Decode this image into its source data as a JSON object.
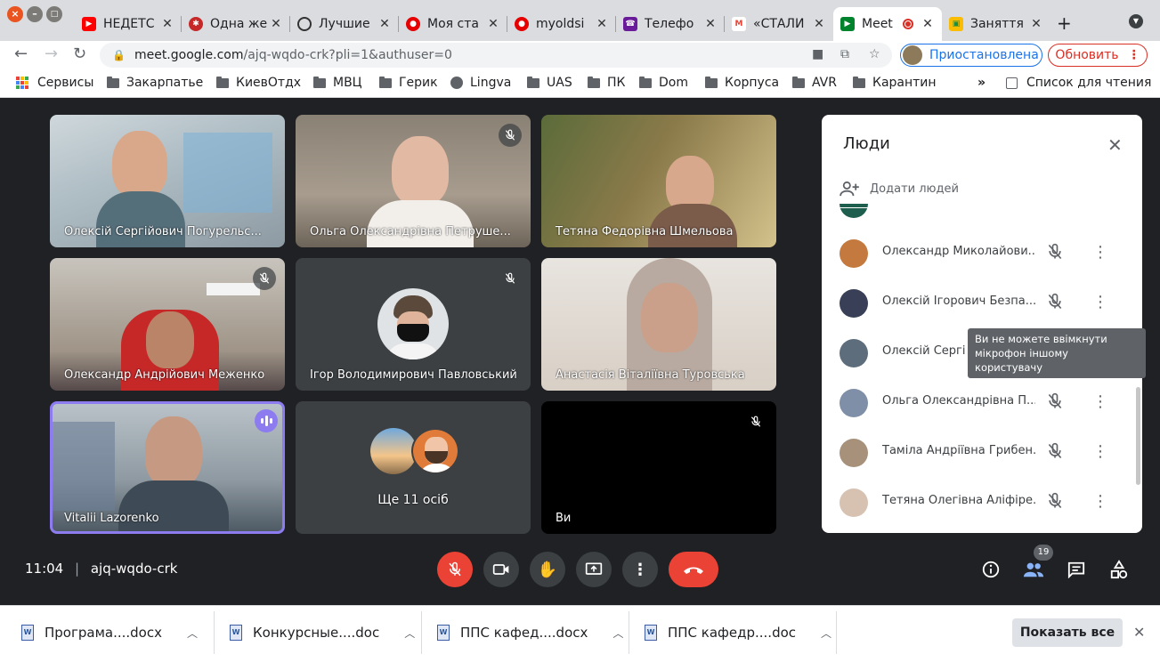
{
  "browser": {
    "tabs": [
      {
        "title": "НЕДЕТС",
        "favicon": "youtube-icon"
      },
      {
        "title": "Одна же",
        "favicon": "virus-icon"
      },
      {
        "title": "Лучшие",
        "favicon": "spinner-icon"
      },
      {
        "title": "Моя ста",
        "favicon": "vodafone-icon"
      },
      {
        "title": "myoldsi",
        "favicon": "vodafone-icon"
      },
      {
        "title": "Телефо",
        "favicon": "phone-icon"
      },
      {
        "title": "«СТАЛИ",
        "favicon": "gmail-icon"
      },
      {
        "title": "Meet",
        "favicon": "meet-icon"
      },
      {
        "title": "Заняття",
        "favicon": "classroom-icon"
      }
    ],
    "url_host": "meet.google.com",
    "url_path": "/ajq-wqdo-crk?pli=1&authuser=0",
    "profile_label": "Приостановлена",
    "update_label": "Обновить",
    "bookmarks": [
      "Сервисы",
      "Закарпатье",
      "КиевОтдх",
      "МВЦ",
      "Герик",
      "Lingva",
      "UAS",
      "ПК",
      "Dom",
      "Корпуса",
      "AVR",
      "Карантин"
    ],
    "reading_list": "Список для чтения"
  },
  "meet": {
    "tiles": [
      {
        "name": "Олексій Сергійович Погурельс..."
      },
      {
        "name": "Ольга Олександрівна Петруше..."
      },
      {
        "name": "Тетяна Федорівна Шмельова"
      },
      {
        "name": "Олександр Андрійович Меженко"
      },
      {
        "name": "Ігор Володимирович Павловський"
      },
      {
        "name": "Анастасія Віталіївна Туровська"
      },
      {
        "name": "Vitalii Lazorenko"
      },
      {
        "name": "Ще 11 осіб"
      },
      {
        "name": "Ви"
      }
    ],
    "time": "11:04",
    "separator": "|",
    "meeting_code": "ajq-wqdo-crk",
    "participant_count": "19"
  },
  "people_panel": {
    "title": "Люди",
    "add_people": "Додати людей",
    "participants": [
      {
        "name": "Олександр Миколайови..."
      },
      {
        "name": "Олексій Ігорович Безпа..."
      },
      {
        "name": "Олексій Сергі"
      },
      {
        "name": "Ольга Олександрівна П..."
      },
      {
        "name": "Таміла Андріївна Грибен..."
      },
      {
        "name": "Тетяна Олегівна Аліфіре..."
      }
    ],
    "tooltip_line1": "Ви не можете ввімкнути",
    "tooltip_line2": "мікрофон іншому користувачу"
  },
  "downloads": {
    "items": [
      {
        "name": "Програма....docx"
      },
      {
        "name": "Конкурсные....doc"
      },
      {
        "name": "ППС кафед....docx"
      },
      {
        "name": "ППС кафедр....doc"
      }
    ],
    "show_all": "Показать все"
  },
  "colors": {
    "meet_bg": "#202124",
    "end_call": "#ea4335",
    "active_speaker": "#8c7cf0",
    "update_red": "#d93025",
    "link_blue": "#1a73e8"
  }
}
